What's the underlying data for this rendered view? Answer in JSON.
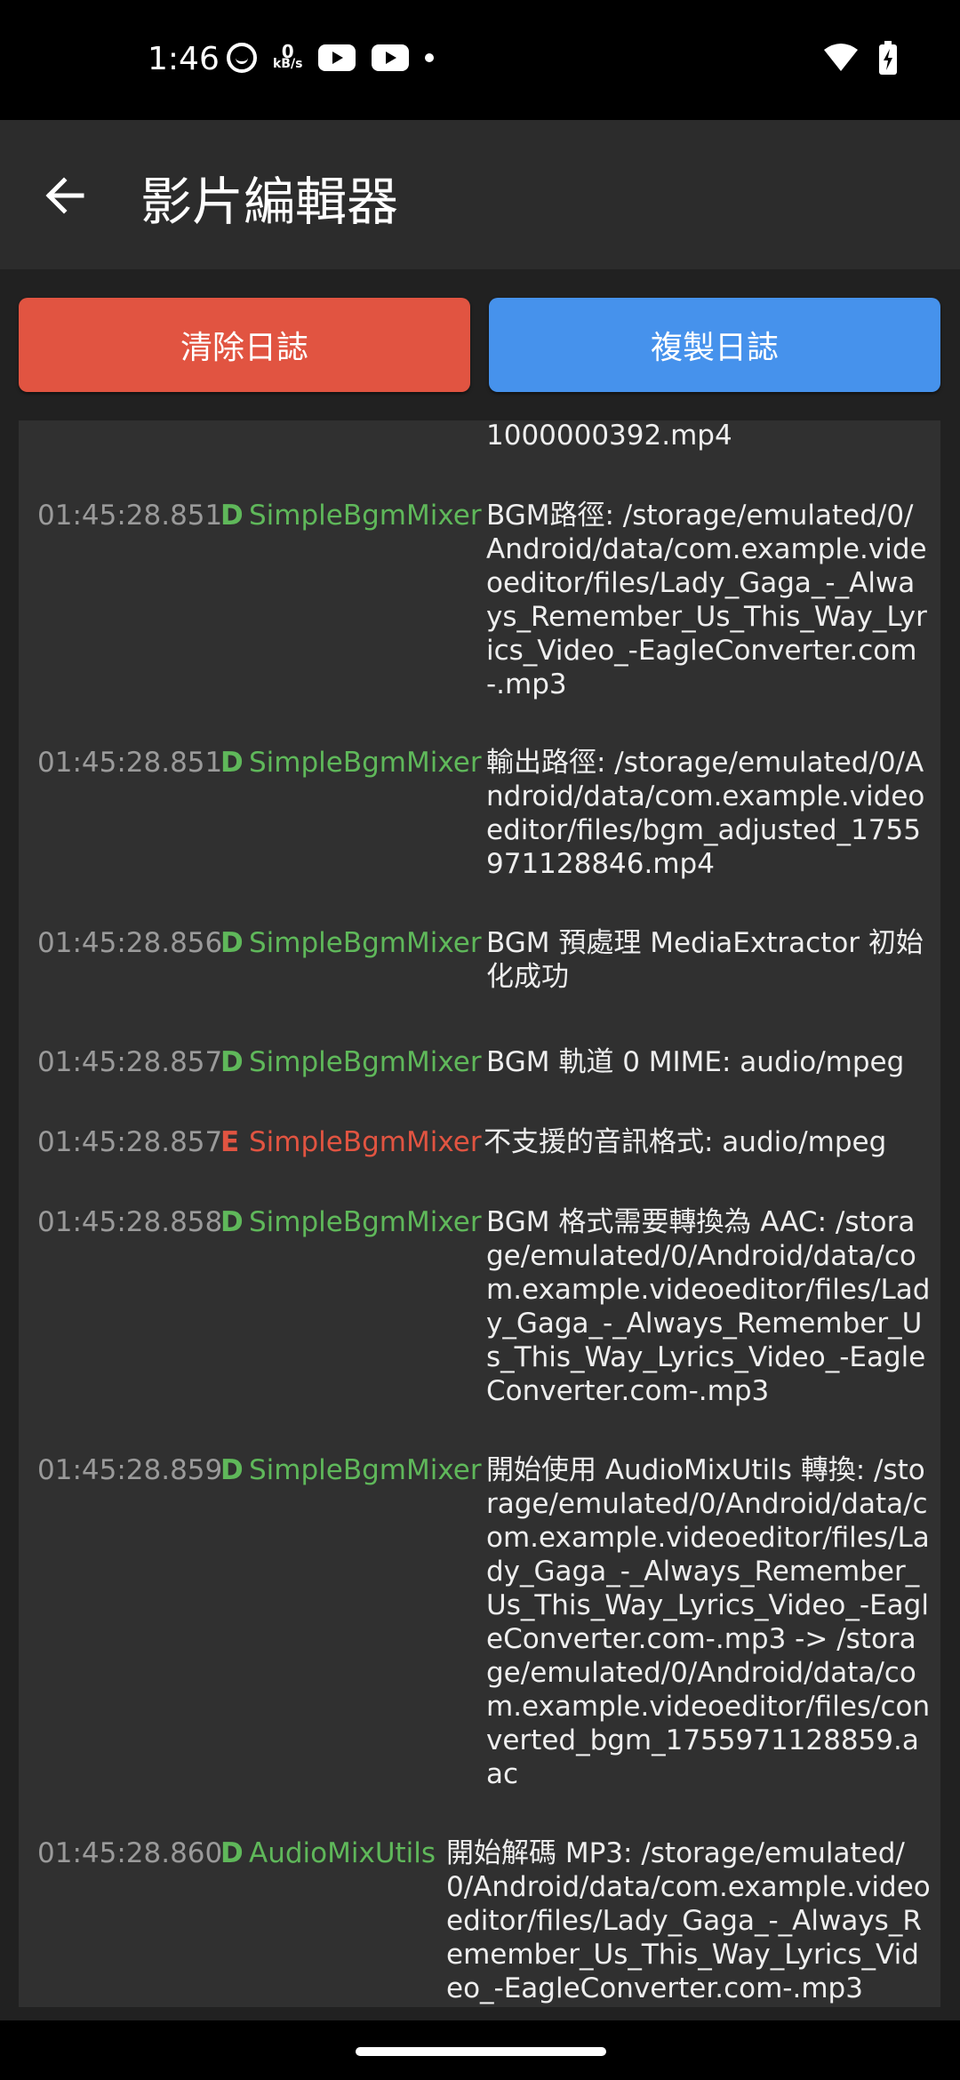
{
  "status_bar": {
    "time": "1:46",
    "net_speed_value": "0",
    "net_speed_unit": "kB/s",
    "icons": [
      "face-icon",
      "youtube-icon",
      "youtube-icon",
      "dot-icon",
      "wifi-icon",
      "battery-charging-icon"
    ]
  },
  "app_bar": {
    "title": "影片編輯器",
    "back_icon": "arrow-left-icon"
  },
  "actions": {
    "clear_label": "清除日誌",
    "copy_label": "複製日誌",
    "clear_color": "#e15441",
    "copy_color": "#4692ec"
  },
  "colors": {
    "debug": "#5fb85a",
    "error": "#e15441",
    "panel": "#303030",
    "background": "#212121"
  },
  "log": [
    {
      "time": "",
      "level": "",
      "tag": "",
      "msg": "1000000392.mp4"
    },
    {
      "time": "01:45:28.851",
      "level": "D",
      "tag": "SimpleBgmMixer",
      "msg": "BGM路徑: /storage/emulated/0/Android/data/com.example.videoeditor/files/Lady_Gaga_-_Always_Remember_Us_This_Way_Lyrics_Video_-EagleConverter.com-.mp3"
    },
    {
      "time": "01:45:28.851",
      "level": "D",
      "tag": "SimpleBgmMixer",
      "msg": "輸出路徑: /storage/emulated/0/Android/data/com.example.videoeditor/files/bgm_adjusted_1755971128846.mp4"
    },
    {
      "time": "01:45:28.856",
      "level": "D",
      "tag": "SimpleBgmMixer",
      "msg": "BGM 預處理 MediaExtractor 初始化成功"
    },
    {
      "time": "01:45:28.857",
      "level": "D",
      "tag": "SimpleBgmMixer",
      "msg": "BGM 軌道 0 MIME: audio/mpeg"
    },
    {
      "time": "01:45:28.857",
      "level": "E",
      "tag": "SimpleBgmMixer",
      "msg": "不支援的音訊格式: audio/mpeg"
    },
    {
      "time": "01:45:28.858",
      "level": "D",
      "tag": "SimpleBgmMixer",
      "msg": "BGM 格式需要轉換為 AAC: /storage/emulated/0/Android/data/com.example.videoeditor/files/Lady_Gaga_-_Always_Remember_Us_This_Way_Lyrics_Video_-EagleConverter.com-.mp3"
    },
    {
      "time": "01:45:28.859",
      "level": "D",
      "tag": "SimpleBgmMixer",
      "msg": "開始使用 AudioMixUtils 轉換: /storage/emulated/0/Android/data/com.example.videoeditor/files/Lady_Gaga_-_Always_Remember_Us_This_Way_Lyrics_Video_-EagleConverter.com-.mp3 -> /storage/emulated/0/Android/data/com.example.videoeditor/files/converted_bgm_1755971128859.aac"
    },
    {
      "time": "01:45:28.860",
      "level": "D",
      "tag": "AudioMixUtils",
      "msg": "開始解碼 MP3: /storage/emulated/0/Android/data/com.example.videoeditor/files/Lady_Gaga_-_Always_Remember_Us_This_Way_Lyrics_Video_-EagleConverter.com-.mp3"
    }
  ]
}
